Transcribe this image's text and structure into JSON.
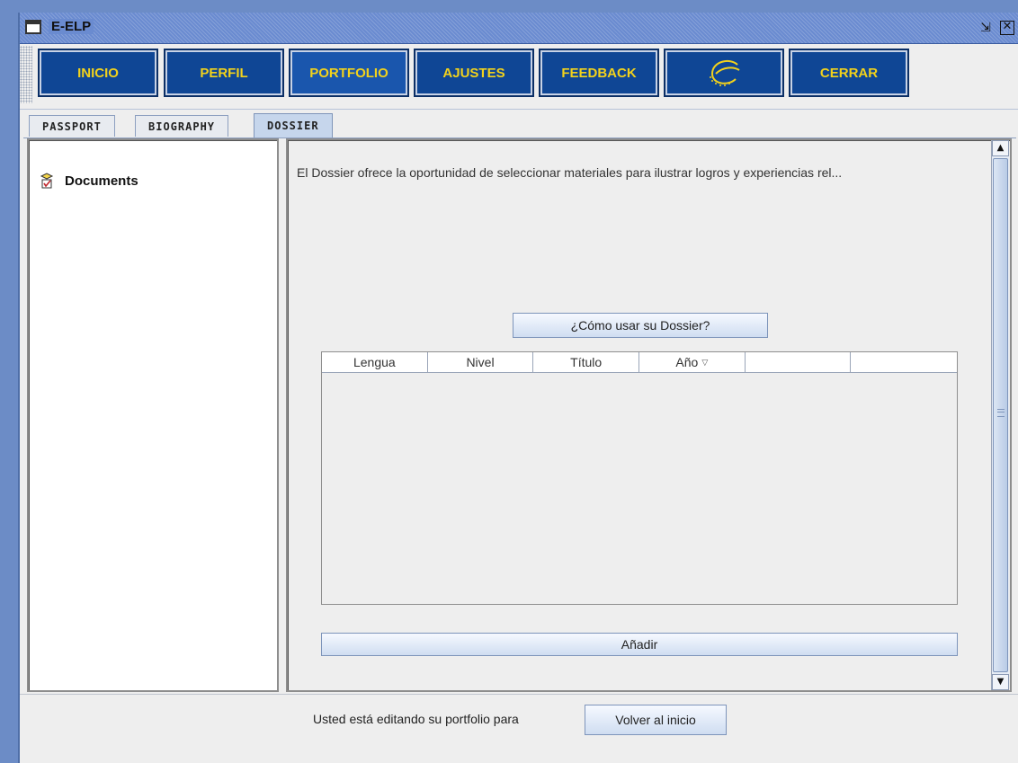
{
  "window": {
    "title": "E-ELP"
  },
  "nav": {
    "items": [
      {
        "label": "INICIO"
      },
      {
        "label": "PERFIL"
      },
      {
        "label": "PORTFOLIO"
      },
      {
        "label": "AJUSTES"
      },
      {
        "label": "FEEDBACK"
      },
      {
        "label": "",
        "icon": "council-of-europe-logo"
      },
      {
        "label": "CERRAR"
      }
    ],
    "text_color": "#f2d21c",
    "button_color": "#0f4695"
  },
  "tabs": [
    {
      "label": "PASSPORT"
    },
    {
      "label": "BIOGRAPHY"
    },
    {
      "label": "DOSSIER",
      "selected": true
    }
  ],
  "tree": {
    "items": [
      {
        "label": "Documents",
        "icon": "document-check-icon"
      }
    ]
  },
  "dossier": {
    "description": "El Dossier ofrece la oportunidad de seleccionar materiales para ilustrar logros y experiencias rel...",
    "howto_button": "¿Cómo usar su Dossier?",
    "table": {
      "columns": [
        "Lengua",
        "Nivel",
        "Título",
        "Año",
        "",
        ""
      ],
      "sorted_column": "Año",
      "rows": []
    },
    "add_button": "Añadir"
  },
  "footer": {
    "text": "Usted está editando su portfolio para",
    "back_button": "Volver al inicio"
  }
}
